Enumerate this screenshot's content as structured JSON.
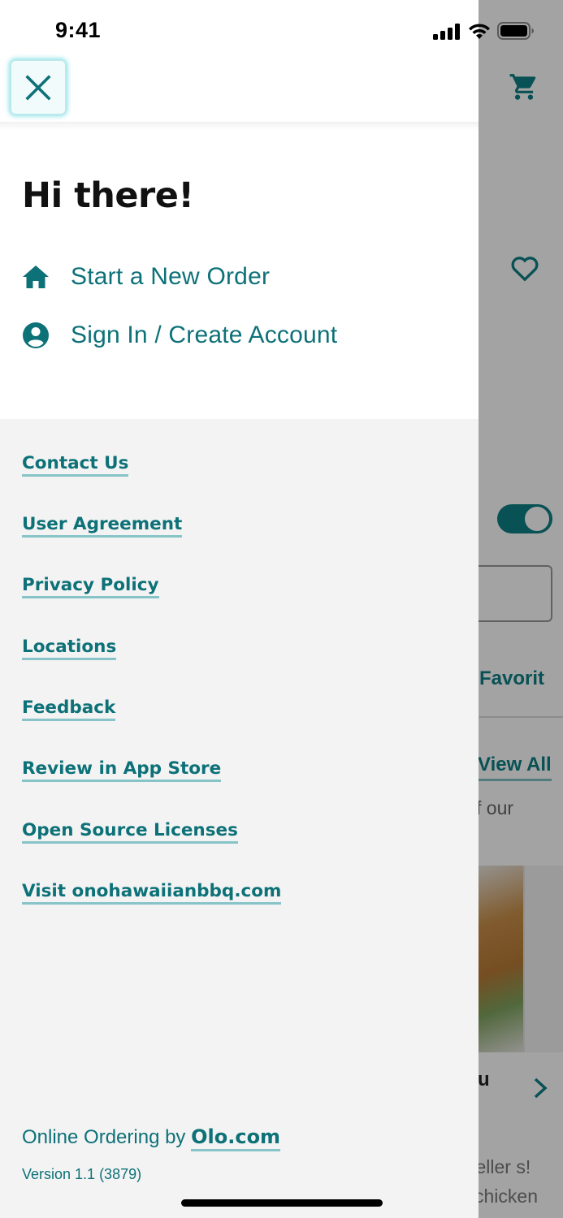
{
  "status_bar": {
    "time": "9:41"
  },
  "drawer": {
    "greeting": "Hi there!",
    "menu": [
      {
        "label": "Start a New Order",
        "icon": "home-icon"
      },
      {
        "label": "Sign In / Create Account",
        "icon": "account-circle-icon"
      }
    ],
    "links": [
      "Contact Us",
      "User Agreement",
      "Privacy Policy",
      "Locations",
      "Feedback",
      "Review in App Store",
      "Open Source Licenses",
      "Visit onohawaiianbbq.com"
    ],
    "footer": {
      "credit_prefix": "Online Ordering by ",
      "credit_link": "Olo.com",
      "version": "Version 1.1 (3879)"
    }
  },
  "background": {
    "tab_favorites": "Favorit",
    "view_all": "View All",
    "subtext": "f our",
    "card_title": "u",
    "card_line1": "seller s!",
    "card_line2": "chicken"
  },
  "colors": {
    "accent": "#0d7178",
    "accent_underline": "#87c4c8",
    "drawer_bottom_bg": "#f3f3f3",
    "close_glow": "#67d6de"
  }
}
